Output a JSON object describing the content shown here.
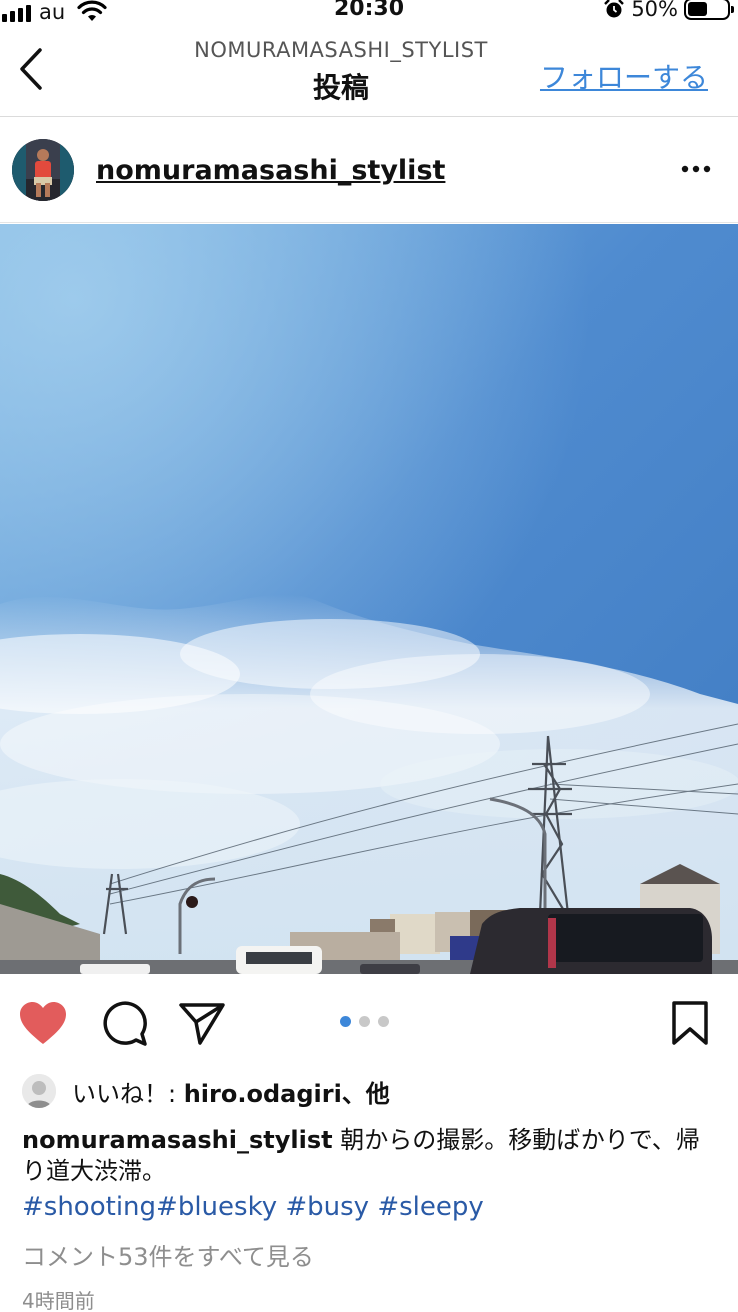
{
  "status_bar": {
    "carrier": "au",
    "time": "20:30",
    "battery_percent": "50%",
    "battery_level": 0.5,
    "icons": [
      "signal-icon",
      "wifi-icon",
      "alarm-icon",
      "battery-icon"
    ]
  },
  "header": {
    "subtitle": "NOMURAMASASHI_STYLIST",
    "title": "投稿",
    "follow_label": "フォローする",
    "back_icon": "chevron-left-icon"
  },
  "post": {
    "username": "nomuramasashi_stylist",
    "more_icon": "more-horizontal-icon",
    "photo_icon": "post-photo",
    "carousel_total": 3,
    "carousel_active": 1
  },
  "actions": {
    "like_icon": "heart-icon",
    "liked": true,
    "like_color": "#e25c5c",
    "comment_icon": "comment-icon",
    "share_icon": "send-icon",
    "save_icon": "bookmark-icon",
    "accent_color": "#3d87d9"
  },
  "likes": {
    "prefix": "いいね！: ",
    "liker": "hiro.odagiri",
    "suffix": "、他"
  },
  "caption": {
    "username": "nomuramasashi_stylist",
    "text": " 朝からの撮影。移動ばかりで、帰り道大渋滞。",
    "hashtags": [
      "#shooting",
      "#bluesky",
      " #busy",
      " #sleepy"
    ],
    "hashtag_color": "#2a5aa6"
  },
  "comments_link": "コメント53件をすべて見る",
  "timestamp": "4時間前"
}
